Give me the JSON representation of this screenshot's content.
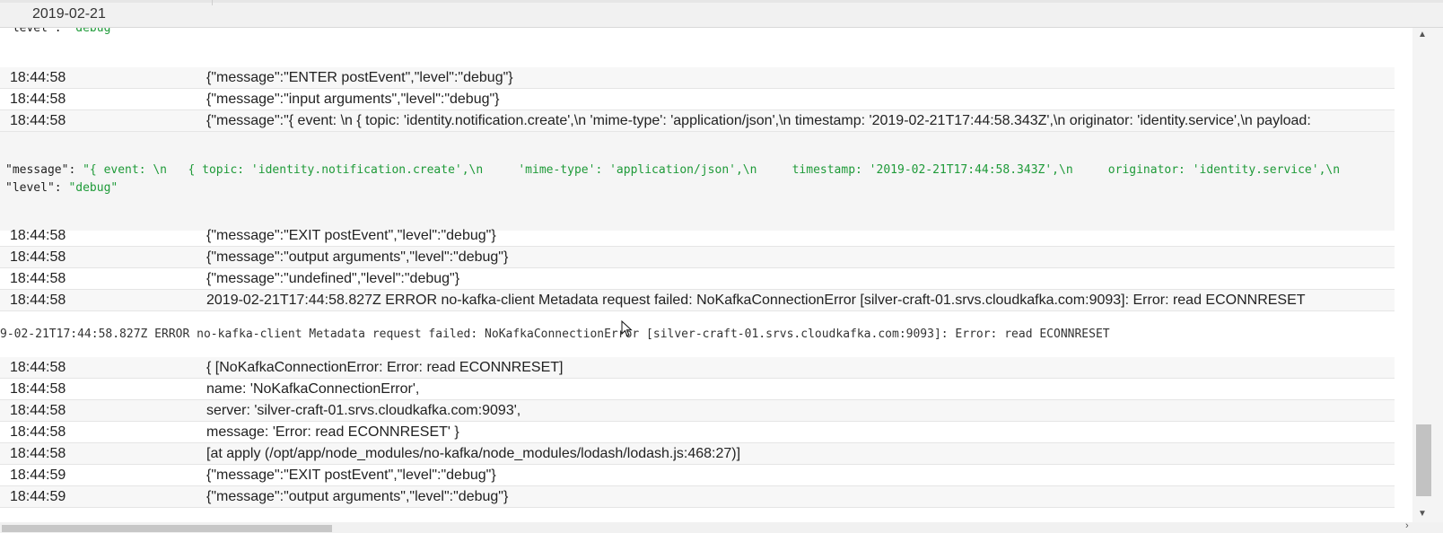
{
  "header": {
    "date": "2019-02-21"
  },
  "top_fragment": {
    "key": "\"level\": ",
    "value": "\"debug\""
  },
  "rows_a": [
    {
      "time": "18:44:58",
      "message": "{\"message\":\"ENTER postEvent\",\"level\":\"debug\"}"
    },
    {
      "time": "18:44:58",
      "message": "{\"message\":\"input arguments\",\"level\":\"debug\"}"
    },
    {
      "time": "18:44:58",
      "message": "{\"message\":\"{ event: \\n { topic: 'identity.notification.create',\\n 'mime-type': 'application/json',\\n timestamp: '2019-02-21T17:44:58.343Z',\\n originator: 'identity.service',\\n payload:"
    }
  ],
  "json_detail": {
    "message_key": "\"message\": ",
    "message_value": "\"{ event: \\n   { topic: 'identity.notification.create',\\n     'mime-type': 'application/json',\\n     timestamp: '2019-02-21T17:44:58.343Z',\\n     originator: 'identity.service',\\n",
    "level_key": "\"level\": ",
    "level_value": "\"debug\""
  },
  "rows_b": [
    {
      "time": "18:44:58",
      "message": "{\"message\":\"EXIT postEvent\",\"level\":\"debug\"}"
    },
    {
      "time": "18:44:58",
      "message": "{\"message\":\"output arguments\",\"level\":\"debug\"}"
    },
    {
      "time": "18:44:58",
      "message": "{\"message\":\"undefined\",\"level\":\"debug\"}"
    },
    {
      "time": "18:44:58",
      "message": "2019-02-21T17:44:58.827Z ERROR no-kafka-client Metadata request failed: NoKafkaConnectionError [silver-craft-01.srvs.cloudkafka.com:9093]: Error: read ECONNRESET"
    }
  ],
  "text_detail": "9-02-21T17:44:58.827Z ERROR no-kafka-client Metadata request failed: NoKafkaConnectionError [silver-craft-01.srvs.cloudkafka.com:9093]: Error: read ECONNRESET",
  "rows_c": [
    {
      "time": "18:44:58",
      "message": "{ [NoKafkaConnectionError: Error: read ECONNRESET]"
    },
    {
      "time": "18:44:58",
      "message": "name: 'NoKafkaConnectionError',"
    },
    {
      "time": "18:44:58",
      "message": "server: 'silver-craft-01.srvs.cloudkafka.com:9093',"
    },
    {
      "time": "18:44:58",
      "message": "message: 'Error: read ECONNRESET' }"
    },
    {
      "time": "18:44:58",
      "message": "[at apply (/opt/app/node_modules/no-kafka/node_modules/lodash/lodash.js:468:27)]"
    },
    {
      "time": "18:44:59",
      "message": "{\"message\":\"EXIT postEvent\",\"level\":\"debug\"}"
    },
    {
      "time": "18:44:59",
      "message": "{\"message\":\"output arguments\",\"level\":\"debug\"}"
    }
  ],
  "icons": {
    "scroll_up": "▲",
    "scroll_down": "▼",
    "scroll_right": "›",
    "cursor": "mouse-pointer"
  },
  "colors": {
    "json_string": "#1e9a38",
    "row_alt": "#f7f7f7",
    "detail_bg": "#f5f5f5"
  }
}
